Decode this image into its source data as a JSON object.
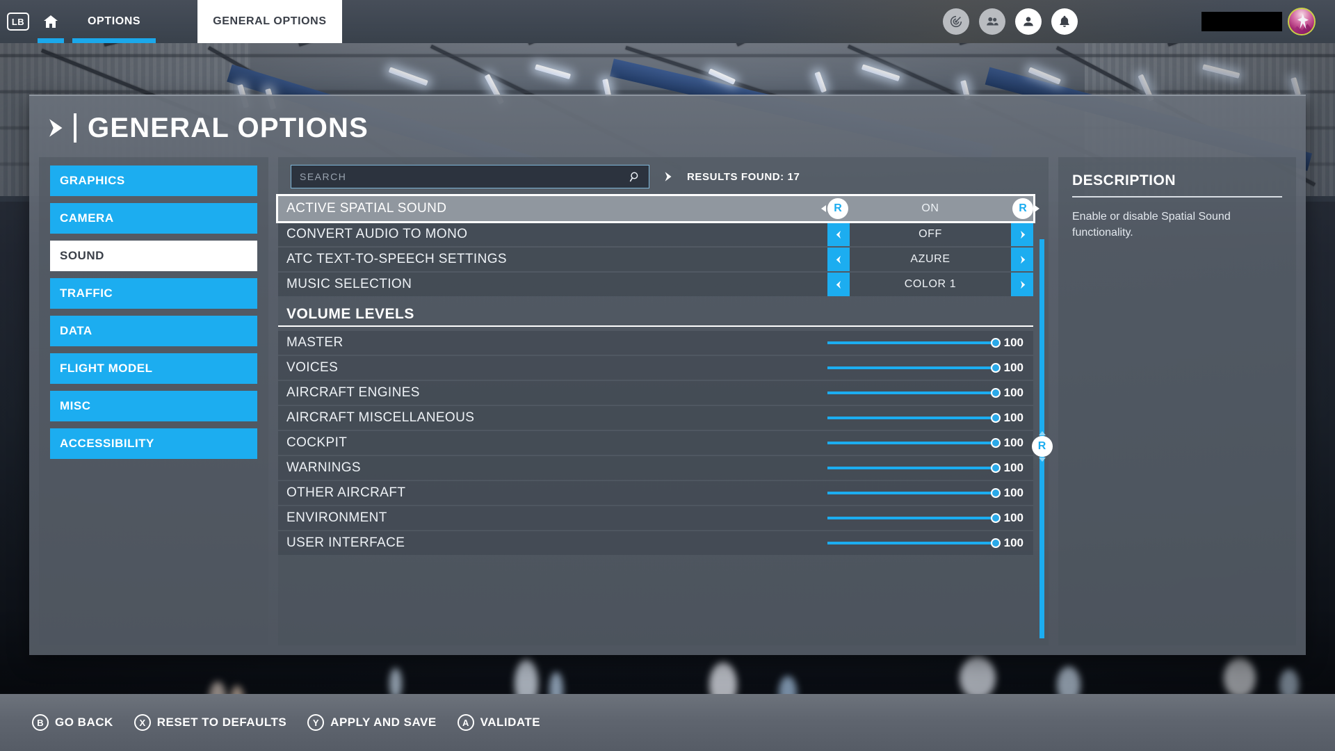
{
  "topbar": {
    "lb_badge": "LB",
    "home_icon": "home-icon",
    "tab_options": "OPTIONS",
    "tab_general_options": "GENERAL OPTIONS",
    "icons": [
      "radar-icon",
      "friends-icon",
      "profile-icon",
      "notifications-bell-icon"
    ],
    "username_redacted": "",
    "avatar": "user-avatar"
  },
  "page": {
    "title": "GENERAL OPTIONS"
  },
  "sidebar": {
    "items": [
      {
        "label": "GRAPHICS",
        "active": false
      },
      {
        "label": "CAMERA",
        "active": false
      },
      {
        "label": "SOUND",
        "active": true
      },
      {
        "label": "TRAFFIC",
        "active": false
      },
      {
        "label": "DATA",
        "active": false
      },
      {
        "label": "FLIGHT MODEL",
        "active": false
      },
      {
        "label": "MISC",
        "active": false
      },
      {
        "label": "ACCESSIBILITY",
        "active": false
      }
    ]
  },
  "search": {
    "value": "",
    "placeholder": "SEARCH",
    "icon": "search-icon",
    "results_label": "RESULTS FOUND: 17"
  },
  "settings": {
    "rows": [
      {
        "label": "ACTIVE SPATIAL SOUND",
        "value": "ON",
        "selected": true,
        "prev_key": "R",
        "next_key": "R"
      },
      {
        "label": "CONVERT AUDIO TO MONO",
        "value": "OFF",
        "selected": false
      },
      {
        "label": "ATC TEXT-TO-SPEECH SETTINGS",
        "value": "AZURE",
        "selected": false
      },
      {
        "label": "MUSIC SELECTION",
        "value": "COLOR 1",
        "selected": false
      }
    ],
    "section_title": "VOLUME LEVELS",
    "volumes": [
      {
        "label": "MASTER",
        "value": 100
      },
      {
        "label": "VOICES",
        "value": 100
      },
      {
        "label": "AIRCRAFT ENGINES",
        "value": 100
      },
      {
        "label": "AIRCRAFT MISCELLANEOUS",
        "value": 100
      },
      {
        "label": "COCKPIT",
        "value": 100
      },
      {
        "label": "WARNINGS",
        "value": 100
      },
      {
        "label": "OTHER AIRCRAFT",
        "value": 100
      },
      {
        "label": "ENVIRONMENT",
        "value": 100
      },
      {
        "label": "USER INTERFACE",
        "value": 100
      }
    ],
    "scroll_key": "R",
    "max_volume": 100
  },
  "description": {
    "title": "DESCRIPTION",
    "body": "Enable or disable Spatial Sound functionality."
  },
  "commands": [
    {
      "key": "B",
      "label": "GO BACK"
    },
    {
      "key": "X",
      "label": "RESET TO DEFAULTS"
    },
    {
      "key": "Y",
      "label": "APPLY AND SAVE"
    },
    {
      "key": "A",
      "label": "VALIDATE"
    }
  ],
  "colors": {
    "accent_blue": "#1cadf0",
    "panel_gray": "#5c636e",
    "white": "#ffffff",
    "avatar_ring": "#c9d148"
  }
}
